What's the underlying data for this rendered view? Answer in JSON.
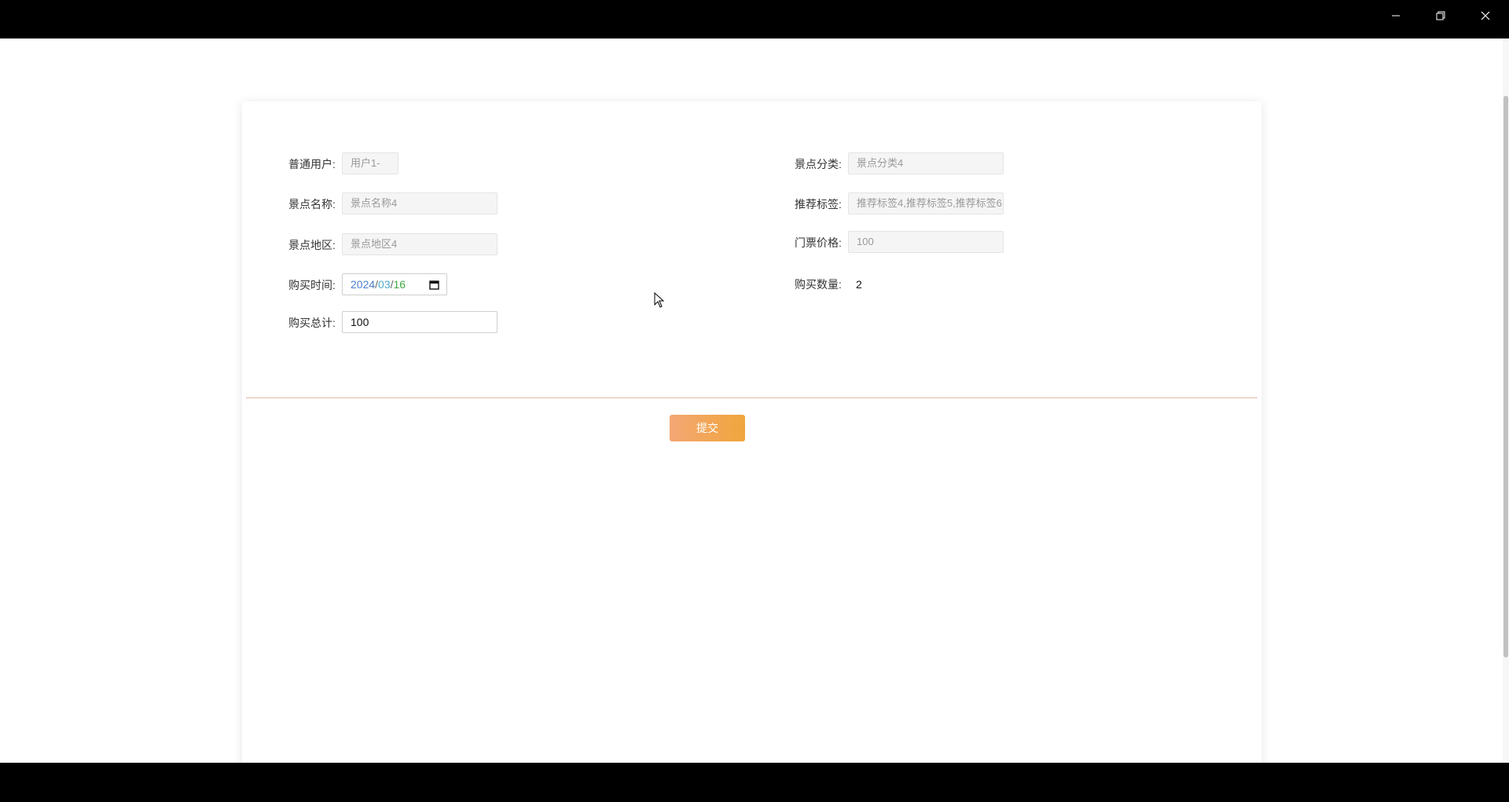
{
  "window": {
    "minimize_icon": "minimize-icon",
    "restore_icon": "restore-icon",
    "close_icon": "close-icon"
  },
  "form": {
    "user": {
      "label": "普通用户:",
      "value": "用户1-"
    },
    "category": {
      "label": "景点分类:",
      "value": "景点分类4"
    },
    "name": {
      "label": "景点名称:",
      "value": "景点名称4"
    },
    "tags": {
      "label": "推荐标签:",
      "value": "推荐标签4,推荐标签5,推荐标签6"
    },
    "region": {
      "label": "景点地区:",
      "value": "景点地区4"
    },
    "price": {
      "label": "门票价格:",
      "value": "100"
    },
    "purchase_time": {
      "label": "购买时间:",
      "year": "2024",
      "month": "03",
      "day": "16",
      "separator": "/",
      "icon": "calendar-icon"
    },
    "quantity": {
      "label": "购买数量:",
      "value": "2"
    },
    "total": {
      "label": "购买总计:",
      "value": "100"
    }
  },
  "actions": {
    "submit_label": "提交"
  },
  "colors": {
    "accent_start": "#f4a774",
    "accent_end": "#f0a63c",
    "divider": "#e8b7a8"
  }
}
